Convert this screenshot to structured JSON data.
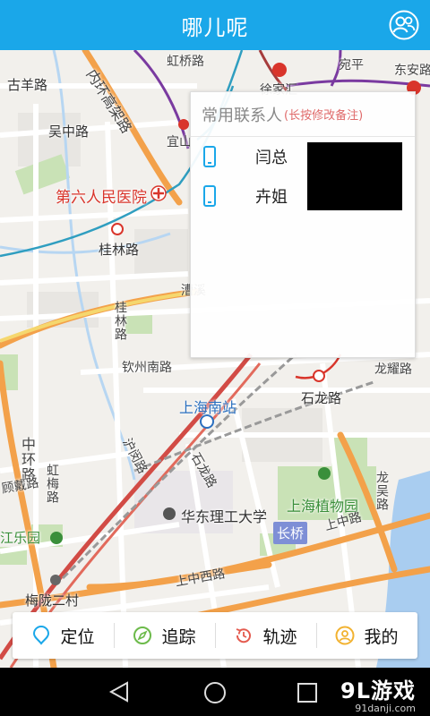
{
  "header": {
    "title": "哪儿呢",
    "contacts_icon": "contacts-icon"
  },
  "map": {
    "labels": {
      "gubeilu": "古羊路",
      "hongqiaolu": "虹桥路",
      "neihuan": "内环高架路",
      "xujiahui": "徐家汇",
      "dongan": "东安路",
      "wanping": "宛平",
      "wuzhong": "吴中路",
      "yishan": "宜山",
      "sixth_hospital": "第六人民医院",
      "guilin": "桂林路",
      "caoxi": "漕溪",
      "guilinlu_v": "桂林路",
      "qinzhou": "钦州南路",
      "shanghai_south": "上海南站",
      "shilong": "石龙路",
      "longyao": "龙耀路",
      "zhonghuan": "中环路",
      "shicheng": "沪闵路",
      "ecust": "华东理工大学",
      "botanical": "上海植物园",
      "jiangle": "江乐园",
      "meilong": "梅陇二村",
      "shangzhong": "上中路",
      "shangzhongxi": "上中西路",
      "changqiao": "长桥",
      "longwu": "龙吴路",
      "shilonglu_v": "石龙路",
      "huamei": "虹梅路",
      "gudai": "顾戴路"
    }
  },
  "contacts": {
    "title": "常用联系人",
    "hint": "(长按修改备注)",
    "items": [
      {
        "name": "闫总"
      },
      {
        "name": "卉姐"
      }
    ]
  },
  "bottom_nav": {
    "items": [
      {
        "label": "定位",
        "icon": "location-pin-icon",
        "color": "#1aa7e9"
      },
      {
        "label": "追踪",
        "icon": "compass-icon",
        "color": "#6cba4a"
      },
      {
        "label": "轨迹",
        "icon": "history-icon",
        "color": "#e45b4f"
      },
      {
        "label": "我的",
        "icon": "user-icon",
        "color": "#f2b230"
      }
    ]
  },
  "watermark": {
    "main": "9L游戏",
    "sub": "91danji.com"
  },
  "colors": {
    "header": "#1aa7e9",
    "accent_red": "#d9352b"
  }
}
